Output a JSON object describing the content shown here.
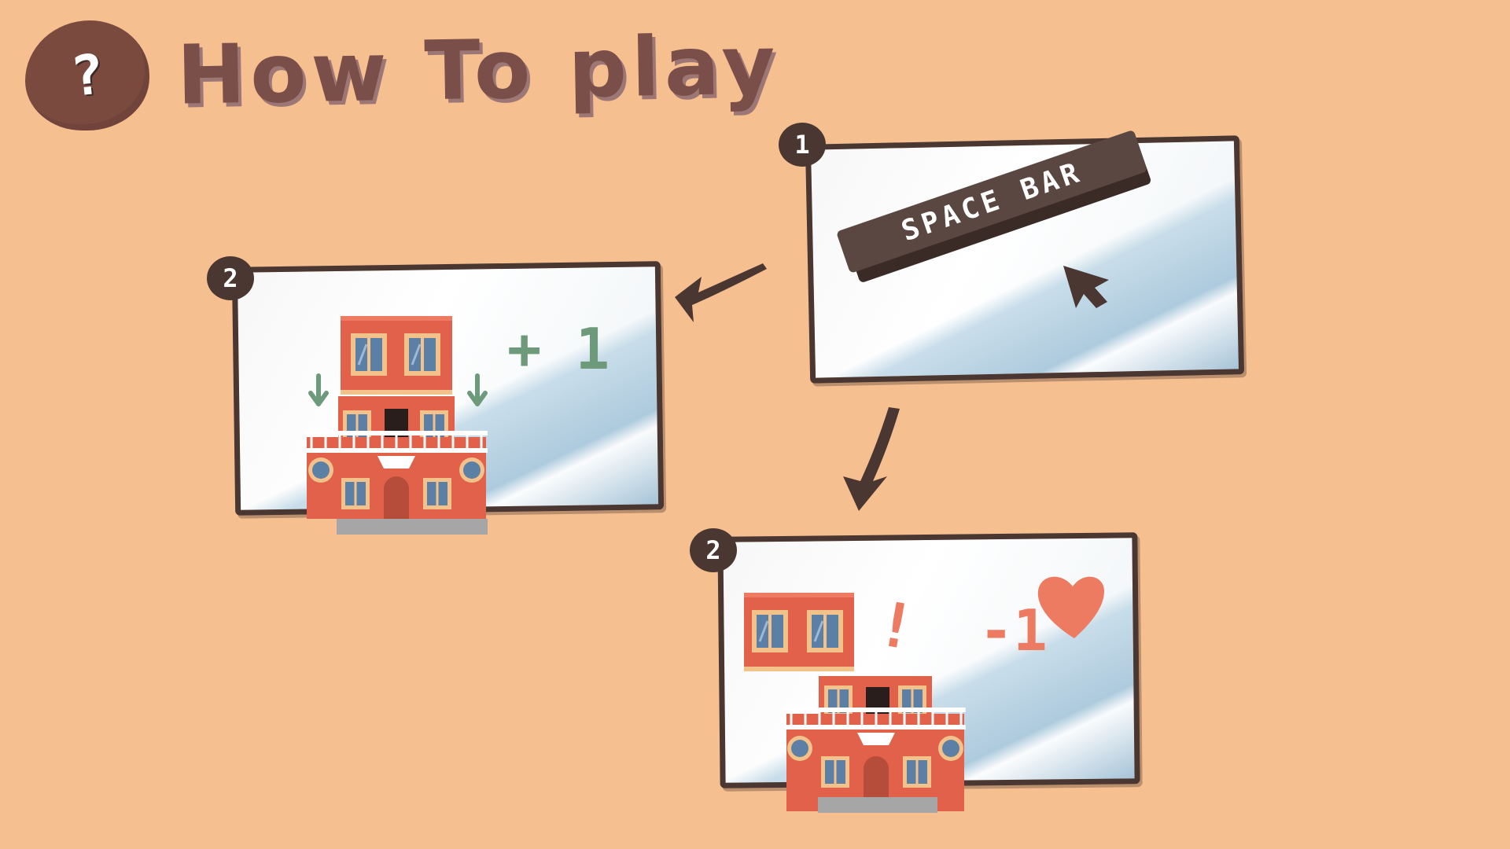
{
  "header": {
    "help_icon_glyph": "?",
    "title": "How To play"
  },
  "steps": {
    "step1": {
      "badge": "1",
      "key_label": "SPACE BAR"
    },
    "step2_success": {
      "badge": "2",
      "score_change": "+ 1"
    },
    "step2_fail": {
      "badge": "2",
      "alert": "!",
      "lives_change": "-1"
    }
  },
  "icons": [
    "help-icon",
    "cursor-arrow-icon",
    "heart-icon",
    "down-arrow-icon",
    "curved-arrow-icon"
  ],
  "colors": {
    "background": "#f6bf90",
    "outline": "#4a3732",
    "success": "#6e9a7c",
    "fail": "#ec7b62",
    "building": "#e2614a"
  }
}
